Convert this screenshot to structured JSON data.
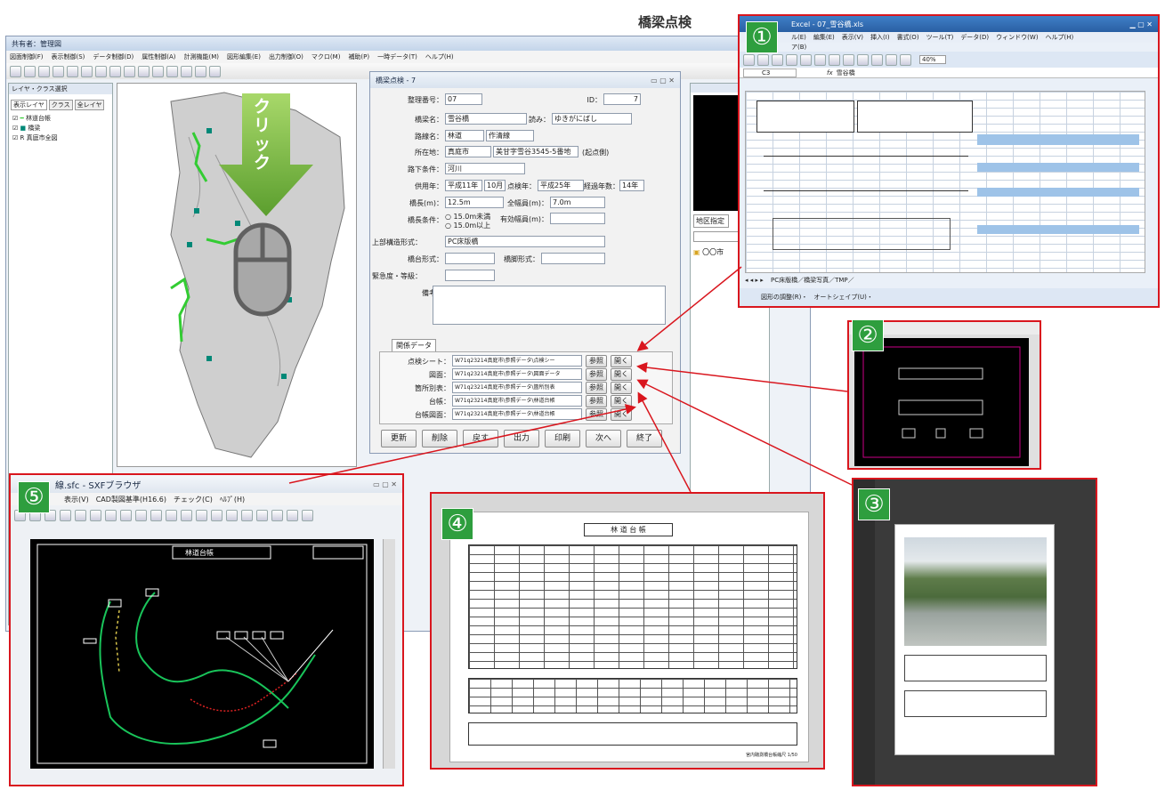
{
  "page_title": "橋梁点検",
  "main_app": {
    "title": "共有者：管理図",
    "menu": [
      "図面制御(F)",
      "表示制御(S)",
      "データ制御(D)",
      "属性制御(A)",
      "計測機能(M)",
      "図形編集(E)",
      "出力制御(O)",
      "マクロ(M)",
      "補助(P)",
      "一時データ(T)",
      "ヘルプ(H)"
    ],
    "layer_panel_title": "レイヤ・クラス選択",
    "layer_tabs": [
      "表示レイヤ",
      "クラス",
      "全レイヤ"
    ],
    "layers": [
      "林道台帳",
      "橋梁",
      "R 真庭市全図"
    ],
    "click_label": "クリック"
  },
  "dialog": {
    "title": "橋梁点検 - 7",
    "fields": {
      "seiri_label": "整理番号：",
      "seiri": "07",
      "id_label": "ID：",
      "id": "7",
      "name_label": "橋梁名：",
      "name": "雪谷橋",
      "yomi_label": "読み：",
      "yomi": "ゆきがにばし",
      "route_label": "路線名：",
      "route_type": "林道",
      "route_name": "作清線",
      "loc_label": "所在地：",
      "loc_city": "真庭市",
      "loc_addr": "美甘字雪谷3545-5番地",
      "loc_note": "(起点側)",
      "under_label": "路下条件：",
      "under": "河川",
      "year_label": "供用年：",
      "year": "平成11年",
      "month": "10月",
      "insp_label": "点検年：",
      "insp": "平成25年",
      "age_label": "経過年数：",
      "age": "14年",
      "len_label": "橋長(m)：",
      "len": "12.5m",
      "width_label": "全幅員(m)：",
      "width": "7.0m",
      "cond_label": "橋長条件：",
      "cond1": "15.0m未満",
      "cond2": "15.0m以上",
      "eff_label": "有効幅員(m)：",
      "upper_label": "上部構造形式：",
      "upper": "PC床版橋",
      "pier_label": "橋台形式：",
      "pier2_label": "橋脚形式：",
      "grade_label": "緊急度・等級：",
      "note_label": "備考："
    },
    "related_tab": "関係データ",
    "related": [
      {
        "label": "点検シート：",
        "path": "W71q23214真庭市\\参照データ\\点検シー"
      },
      {
        "label": "図面：",
        "path": "W71q23214真庭市\\参照データ\\図面データ"
      },
      {
        "label": "箇所別表：",
        "path": "W71q23214真庭市\\参照データ\\箇所別表"
      },
      {
        "label": "台帳：",
        "path": "W71q23214真庭市\\参照データ\\林道台帳"
      },
      {
        "label": "台帳図面：",
        "path": "W71q23214真庭市\\参照データ\\林道台帳"
      }
    ],
    "ref_btn": "参照",
    "open_btn": "開く",
    "bottom_buttons": [
      "更新",
      "削除",
      "戻す",
      "出力",
      "印刷",
      "次へ",
      "終了"
    ]
  },
  "side_panel": {
    "tab": "地区指定",
    "tree_item": "〇〇市"
  },
  "excel": {
    "title": "Excel - 07_雪谷橋.xls",
    "menu": [
      "ル(E)",
      "編集(E)",
      "表示(V)",
      "挿入(I)",
      "書式(O)",
      "ツール(T)",
      "データ(D)",
      "ウィンドウ(W)",
      "ヘルプ(H)"
    ],
    "menu2": "ア(B)",
    "zoom": "40%",
    "cell_ref": "C3",
    "formula": "雪谷橋",
    "sheet_tabs": "PC床版橋／橋梁写真／TMP／",
    "drawbar": "図形の調整(R)・　オートシェイプ(U)・"
  },
  "sxf": {
    "title": "線.sfc - SXFブラウザ",
    "menu": [
      "表示(V)",
      "CAD製図基準(H16.6)",
      "チェック(C)",
      "ﾍﾙﾌﾟ(H)"
    ],
    "drawing_title": "林道台帳"
  },
  "doc4": {
    "title": "林 道 台 帳",
    "footer": "宮内聴測橋台帳縮尺 1/50"
  },
  "labels": [
    "①",
    "②",
    "③",
    "④",
    "⑤"
  ],
  "colors": {
    "accent_red": "#d9161e",
    "badge_green": "#2e9e3e",
    "arrow_green": "#8dc63f",
    "cad_black": "#000000"
  }
}
